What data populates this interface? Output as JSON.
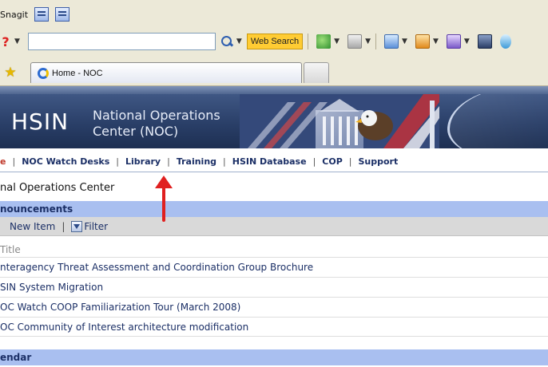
{
  "browser": {
    "toolbar_label": "Snagit",
    "search_button_label": "Web Search",
    "tab_title": "Home - NOC"
  },
  "banner": {
    "logo": "HSIN",
    "subtitle_line1": "National Operations",
    "subtitle_line2": "Center (NOC)"
  },
  "nav": {
    "items": [
      "e",
      "NOC Watch Desks",
      "Library",
      "Training",
      "HSIN Database",
      "COP",
      "Support"
    ]
  },
  "site_title": "nal Operations Center",
  "announcements": {
    "header": "nouncements",
    "toolbar": {
      "new_item_label": "New Item",
      "filter_label": "Filter"
    },
    "column_title": "Title",
    "items": [
      "nteragency Threat Assessment and Coordination Group Brochure",
      "SIN System Migration",
      "OC Watch COOP Familiarization Tour (March 2008)",
      "OC Community of Interest architecture modification"
    ]
  },
  "calendar": {
    "header": "endar"
  },
  "colors": {
    "banner_bg": "#2a3f68",
    "nav_text": "#1b2f66",
    "section_header_bg": "#a9bff0",
    "toolbar_bg": "#d9d9d9",
    "annotation_arrow": "#e02020",
    "search_button_bg": "#ffcc33"
  }
}
